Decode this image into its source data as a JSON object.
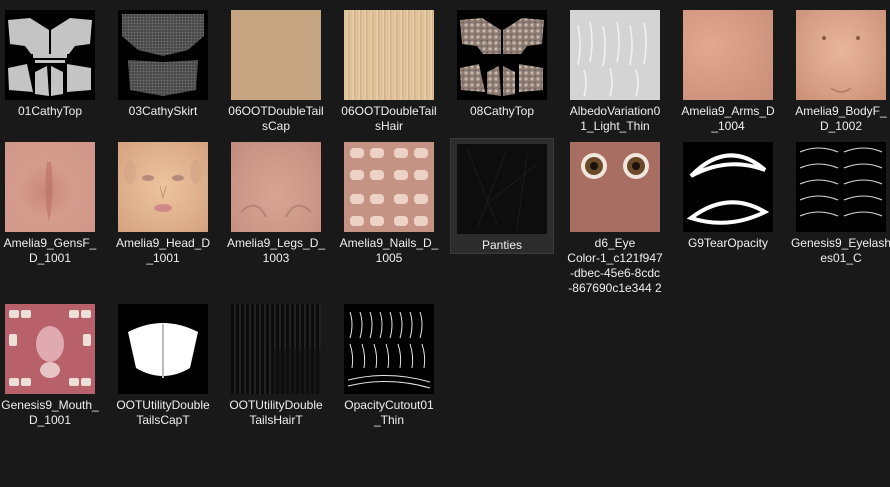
{
  "files": [
    {
      "id": "f01",
      "name": "01CathyTop",
      "thumb": "cathy-top-uv-map"
    },
    {
      "id": "f02",
      "name": "03CathySkirt",
      "thumb": "cathy-skirt-uv-map"
    },
    {
      "id": "f03",
      "name": "06OOTDoubleTail\nsCap",
      "thumb": "skin-solid-texture"
    },
    {
      "id": "f04",
      "name": "06OOTDoubleTail\nsHair",
      "thumb": "hair-streak-texture"
    },
    {
      "id": "f05",
      "name": "08CathyTop",
      "thumb": "cathy-top-pattern-uv-map"
    },
    {
      "id": "f06",
      "name": "AlbedoVariation0\n1_Light_Thin",
      "thumb": "albedo-variation-texture"
    },
    {
      "id": "f07",
      "name": "Amelia9_Arms_D\n_1004",
      "thumb": "arms-skin-texture"
    },
    {
      "id": "f08",
      "name": "Amelia9_BodyF_\nD_1002",
      "thumb": "body-skin-texture"
    },
    {
      "id": "f09",
      "name": "Amelia9_GensF_\nD_1001",
      "thumb": "gens-skin-texture"
    },
    {
      "id": "f10",
      "name": "Amelia9_Head_D\n_1001",
      "thumb": "face-skin-texture"
    },
    {
      "id": "f11",
      "name": "Amelia9_Legs_D_\n1003",
      "thumb": "legs-skin-texture"
    },
    {
      "id": "f12",
      "name": "Amelia9_Nails_D_\n1005",
      "thumb": "nails-texture"
    },
    {
      "id": "f13",
      "name": "Panties",
      "thumb": "dark-fabric-texture",
      "selected": true
    },
    {
      "id": "f14",
      "name": "d6_Eye\nColor-1_c121f947\n-dbec-45e6-8cdc\n-867690c1e344 2",
      "thumb": "eye-color-texture"
    },
    {
      "id": "f15",
      "name": "G9TearOpacity",
      "thumb": "tear-opacity-mask"
    },
    {
      "id": "f16",
      "name": "Genesis9_Eyelash\nes01_C",
      "thumb": "eyelashes-texture"
    },
    {
      "id": "f17",
      "name": "Genesis9_Mouth_\nD_1001",
      "thumb": "mouth-texture"
    },
    {
      "id": "f18",
      "name": "OOTUtilityDouble\nTailsCapT",
      "thumb": "cap-opacity-mask"
    },
    {
      "id": "f19",
      "name": "OOTUtilityDouble\nTailsHairT",
      "thumb": "hair-opacity-mask"
    },
    {
      "id": "f20",
      "name": "OpacityCutout01\n_Thin",
      "thumb": "opacity-cutout-strands"
    }
  ]
}
